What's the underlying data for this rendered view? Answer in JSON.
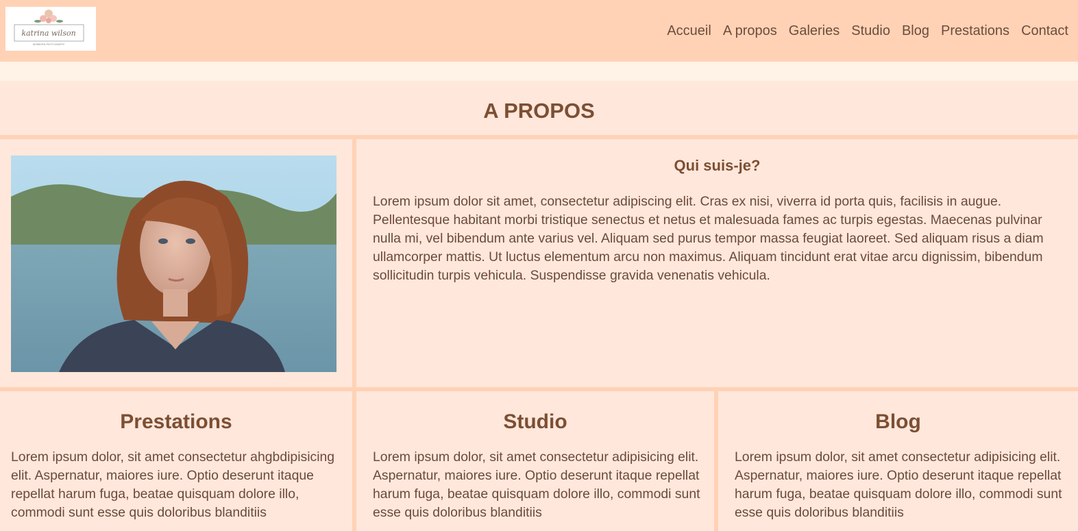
{
  "header": {
    "logo_name": "katrina wilson",
    "logo_tagline": "NEWBORN PHOTOGRAPHY",
    "nav": [
      "Accueil",
      "A propos",
      "Galeries",
      "Studio",
      "Blog",
      "Prestations",
      "Contact"
    ]
  },
  "page": {
    "title": "A PROPOS"
  },
  "about": {
    "heading": "Qui suis-je?",
    "text": "Lorem ipsum dolor sit amet, consectetur adipiscing elit. Cras ex nisi, viverra id porta quis, facilisis in augue. Pellentesque habitant morbi tristique senectus et netus et malesuada fames ac turpis egestas. Maecenas pulvinar nulla mi, vel bibendum ante varius vel. Aliquam sed purus tempor massa feugiat laoreet. Sed aliquam risus a diam ullamcorper mattis. Ut luctus elementum arcu non maximus. Aliquam tincidunt erat vitae arcu dignissim, bibendum sollicitudin turpis vehicula. Suspendisse gravida venenatis vehicula."
  },
  "cards": [
    {
      "heading": "Prestations",
      "text": "Lorem ipsum dolor, sit amet consectetur ahgbdipisicing elit. Aspernatur, maiores iure. Optio deserunt itaque repellat harum fuga, beatae quisquam dolore illo, commodi sunt esse quis doloribus blanditiis"
    },
    {
      "heading": "Studio",
      "text": "Lorem ipsum dolor, sit amet consectetur adipisicing elit. Aspernatur, maiores iure. Optio deserunt itaque repellat harum fuga, beatae quisquam dolore illo, commodi sunt esse quis doloribus blanditiis"
    },
    {
      "heading": "Blog",
      "text": "Lorem ipsum dolor, sit amet consectetur adipisicing elit. Aspernatur, maiores iure. Optio deserunt itaque repellat harum fuga, beatae quisquam dolore illo, commodi sunt esse quis doloribus blanditiis"
    }
  ],
  "colors": {
    "header_bg": "#ffd2b5",
    "panel_bg": "#ffe7db",
    "heading": "#7c4f33",
    "text": "#6b4a3a"
  }
}
